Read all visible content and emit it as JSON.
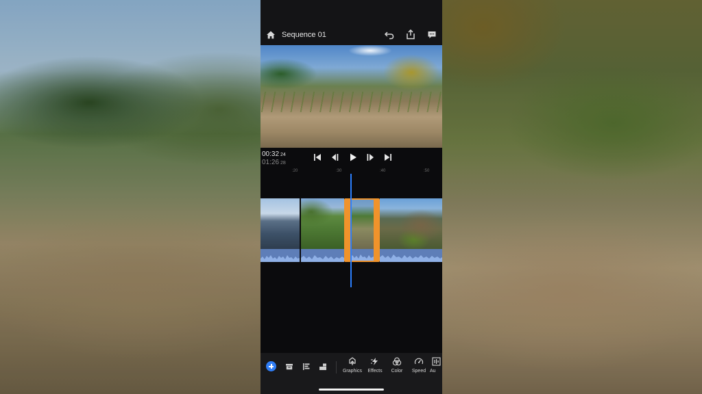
{
  "header": {
    "title": "Sequence 01",
    "home_icon": "home-icon",
    "undo_icon": "undo-icon",
    "share_icon": "share-icon",
    "comment_icon": "comment-icon"
  },
  "player": {
    "current_time": "00:32",
    "current_frame": "24",
    "duration_time": "01:26",
    "duration_frame": "28"
  },
  "ruler": {
    "ticks": [
      ":20",
      ":30",
      ":40",
      ":50"
    ]
  },
  "timeline": {
    "clip_count": 4,
    "selected_clip": 3
  },
  "toolbar": {
    "tools": [
      {
        "label": "Graphics",
        "icon": "graphics-icon"
      },
      {
        "label": "Effects",
        "icon": "effects-icon"
      },
      {
        "label": "Color",
        "icon": "color-icon"
      },
      {
        "label": "Speed",
        "icon": "speed-icon"
      },
      {
        "label": "Au",
        "icon": "audio-icon"
      }
    ]
  },
  "colors": {
    "accent_blue": "#2f7df5",
    "selection_orange": "#f0932b",
    "playhead": "#2b7fff"
  }
}
